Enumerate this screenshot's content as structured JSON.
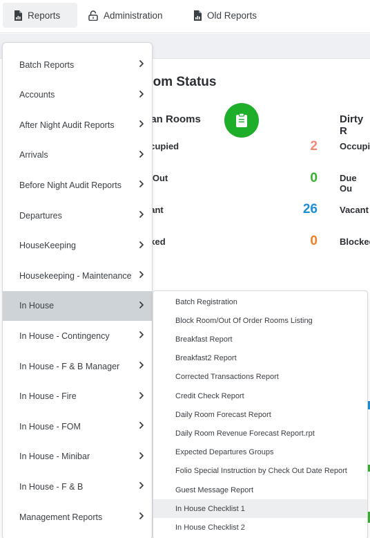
{
  "nav": {
    "tabs": [
      {
        "label": "Reports",
        "icon": "report-file-icon",
        "active": true
      },
      {
        "label": "Administration",
        "icon": "lock-icon",
        "active": false
      },
      {
        "label": "Old Reports",
        "icon": "report-file-icon",
        "active": false
      }
    ]
  },
  "background": {
    "title": "oom Status",
    "clean_heading": "ean Rooms",
    "dirty_heading": "Dirty R",
    "clean_rows": [
      {
        "label": "ccupied",
        "value": "2"
      },
      {
        "label": "e Out",
        "value": "0"
      },
      {
        "label": "cant",
        "value": "26"
      },
      {
        "label": "cked",
        "value": "0"
      }
    ],
    "dirty_rows": [
      "Occupie",
      "Due Ou",
      "Vacant",
      "Blocked"
    ],
    "colors": {
      "occupied": "#f08a78",
      "due_out": "#36b12f",
      "vacant": "#1f8ed6",
      "blocked": "#f07f26",
      "clipboard": "#1fae2a"
    }
  },
  "menu": {
    "items": [
      "Batch Reports",
      "Accounts",
      "After Night Audit Reports",
      "Arrivals",
      "Before Night Audit Reports",
      "Departures",
      "HouseKeeping",
      "Housekeeping - Maintenance",
      "In House",
      "In House - Contingency",
      "In House - F & B Manager",
      "In House - Fire",
      "In House - FOM",
      "In House - Minibar",
      "In House - F & B",
      "Management Reports"
    ],
    "active_index": 8
  },
  "submenu": {
    "items": [
      "Batch Registration",
      "Block Room/Out Of Order Rooms Listing",
      "Breakfast Report",
      "Breakfast2 Report",
      "Corrected Transactions Report",
      "Credit Check Report",
      "Daily Room Forecast Report",
      "Daily Room Revenue Forecast Report.rpt",
      "Expected Departures Groups",
      "Folio Special Instruction by Check Out Date Report",
      "Guest Message Report",
      "In House Checklist 1",
      "In House Checklist 2"
    ],
    "active_index": 11
  }
}
